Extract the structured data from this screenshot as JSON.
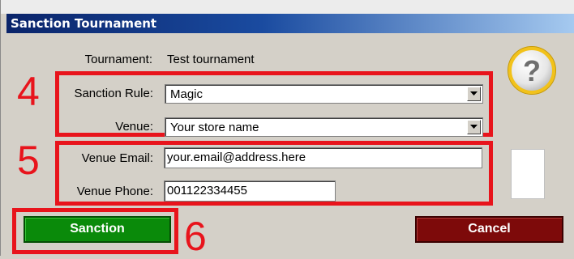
{
  "window": {
    "title": "Sanction Tournament"
  },
  "form": {
    "tournament_label": "Tournament:",
    "tournament_value": "Test tournament",
    "sanction_rule_label": "Sanction Rule:",
    "sanction_rule_value": "Magic",
    "venue_label": "Venue:",
    "venue_value": "Your store name",
    "venue_email_label": "Venue Email:",
    "venue_email_value": "your.email@address.here",
    "venue_phone_label": "Venue Phone:",
    "venue_phone_value": "001122334455"
  },
  "annotations": {
    "n4": "4",
    "n5": "5",
    "n6": "6",
    "color": "#e8141c"
  },
  "buttons": {
    "sanction": "Sanction",
    "cancel": "Cancel"
  },
  "icons": {
    "help": "help-question-icon"
  }
}
